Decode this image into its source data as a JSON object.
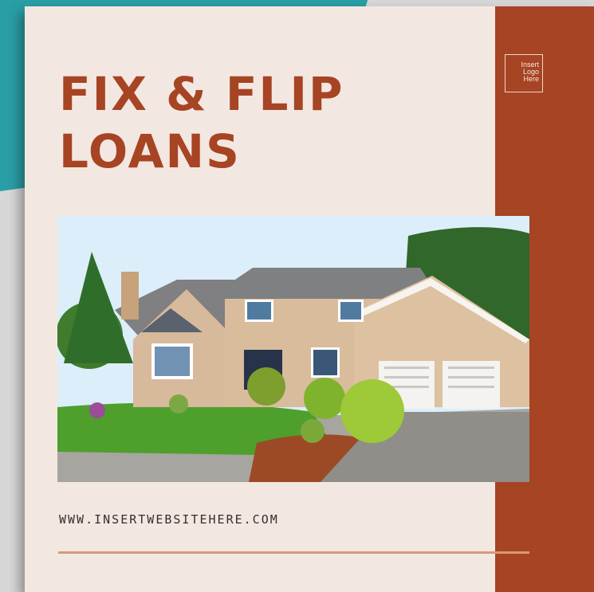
{
  "flyer": {
    "title_line1": "FIX & FLIP",
    "title_line2": "LOANS",
    "logo_placeholder": "Insert\nLogo\nHere",
    "website": "WWW.INSERTWEBSITEHERE.COM",
    "photo_subject": "house-photo"
  },
  "colors": {
    "brand_rust": "#a74423",
    "background_cream": "#f3e8e1",
    "teal_accent": "#2a9ea5",
    "divider_tan": "#d69a76"
  }
}
